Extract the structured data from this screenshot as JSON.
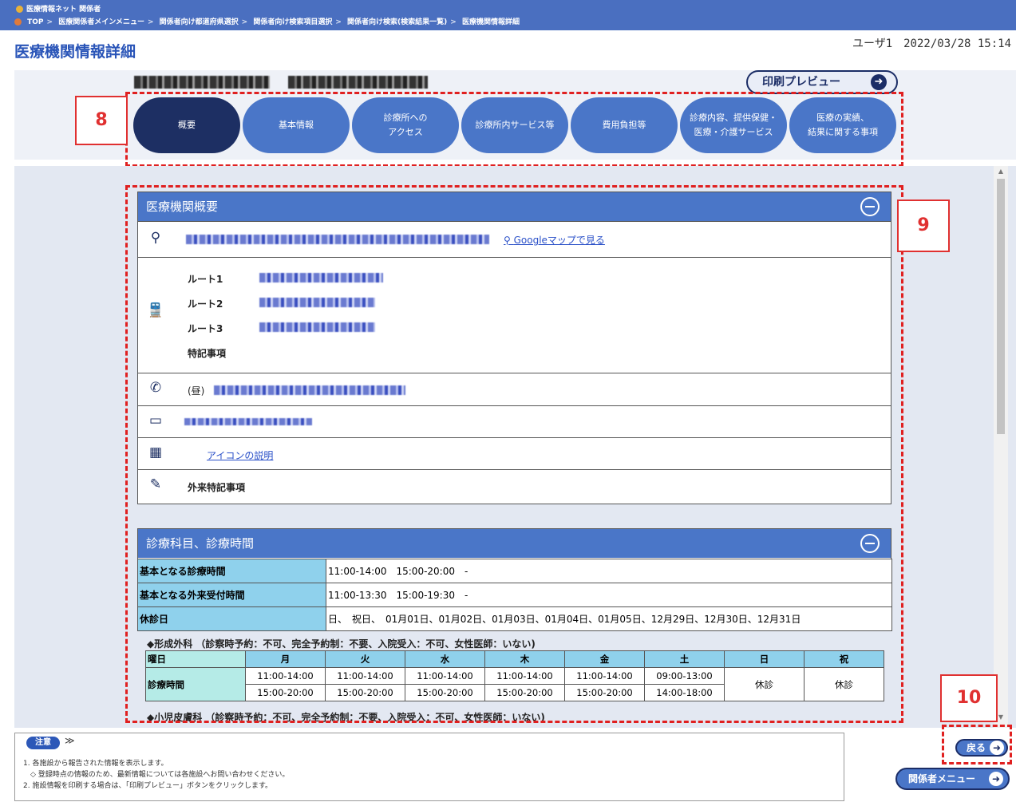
{
  "system_name": "医療情報ネット 関係者",
  "breadcrumbs": [
    "TOP",
    "医療関係者メインメニュー",
    "関係者向け都道府県選択",
    "関係者向け検索項目選択",
    "関係者向け検索(検索結果一覧)",
    "医療機関情報詳細"
  ],
  "page_title": "医療機関情報詳細",
  "user_info": "ユーザ1　2022/03/28 15:14",
  "print_preview_label": "印刷プレビュー",
  "tabs": [
    {
      "label": "概要",
      "active": true
    },
    {
      "label": "基本情報"
    },
    {
      "label": "診療所への\nアクセス"
    },
    {
      "label": "診療所内サービス等"
    },
    {
      "label": "費用負担等"
    },
    {
      "label": "診療内容、提供保健・\n医療・介護サービス"
    },
    {
      "label": "医療の実績、\n結果に関する事項"
    }
  ],
  "annotations": {
    "a8": "8",
    "a9": "9",
    "a10": "10"
  },
  "overview": {
    "title": "医療機関概要",
    "map_link": "Googleマップで見る",
    "routes": [
      {
        "label": "ルート1"
      },
      {
        "label": "ルート2"
      },
      {
        "label": "ルート3"
      }
    ],
    "special_notes_label": "特記事項",
    "phone_prefix": "(昼)",
    "icon_help_link": "アイコンの説明",
    "outpatient_notes_label": "外来特記事項"
  },
  "hours_section": {
    "title": "診療科目、診療時間",
    "rows": [
      {
        "label": "基本となる診療時間",
        "value": "11:00-14:00　15:00-20:00　-"
      },
      {
        "label": "基本となる外来受付時間",
        "value": "11:00-13:30　15:00-19:30　-"
      },
      {
        "label": "休診日",
        "value": "日、　祝日、　01月01日、01月02日、01月03日、01月04日、01月05日、12月29日、12月30日、12月31日"
      }
    ],
    "dept1_heading": "◆形成外科 （診察時予約：不可、完全予約制：不要、入院受入：不可、女性医師：いない)",
    "schedule": {
      "day_header": "曜日",
      "days": [
        "月",
        "火",
        "水",
        "木",
        "金",
        "土",
        "日",
        "祝"
      ],
      "row_label": "診療時間",
      "morning": [
        "11:00-14:00",
        "11:00-14:00",
        "11:00-14:00",
        "11:00-14:00",
        "11:00-14:00",
        "09:00-13:00"
      ],
      "afternoon": [
        "15:00-20:00",
        "15:00-20:00",
        "15:00-20:00",
        "15:00-20:00",
        "15:00-20:00",
        "14:00-18:00"
      ],
      "closed": "休診"
    },
    "dept2_heading": "◆小児皮膚科 （診察時予約：不可、完全予約制：不要、入院受入：不可、女性医師：いない)"
  },
  "notes": {
    "badge": "注意",
    "lines": [
      "1. 各施設から報告された情報を表示します。",
      "　◇ 登録時点の情報のため、最新情報については各施設へお問い合わせください。",
      "2. 施設情報を印刷する場合は、「印刷プレビュー」ボタンをクリックします。"
    ]
  },
  "back_label": "戻る",
  "menu_label": "関係者メニュー"
}
